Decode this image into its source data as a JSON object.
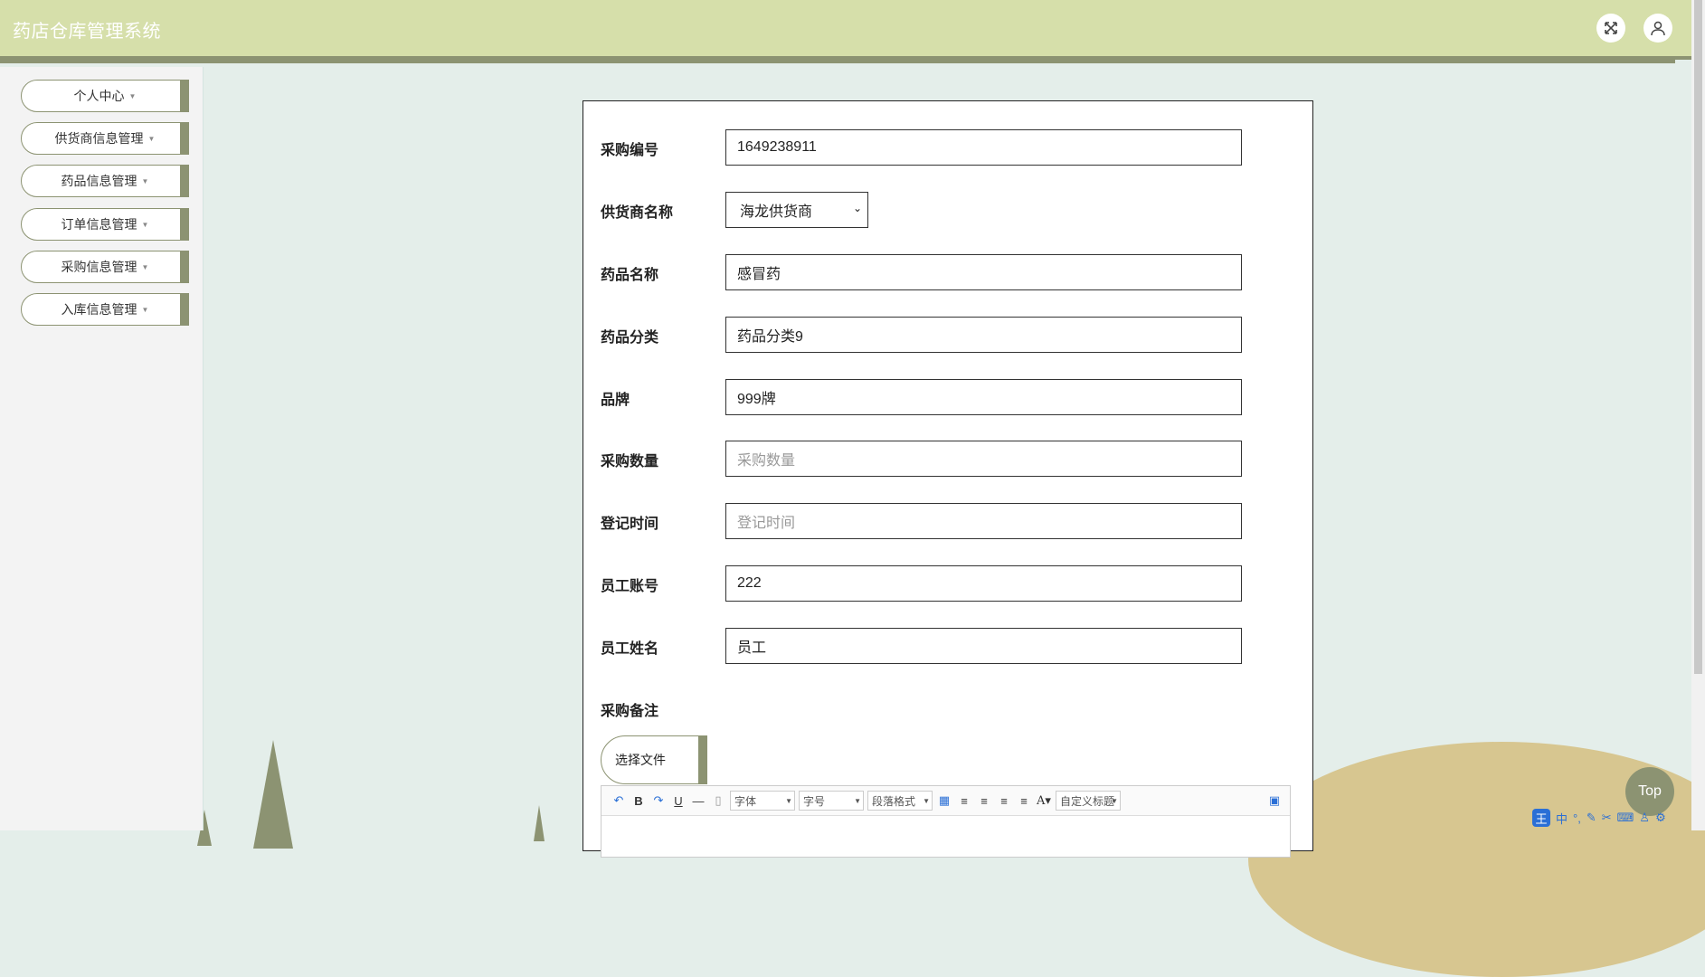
{
  "app": {
    "title": "药店仓库管理系统"
  },
  "header": {
    "fullscreen_icon": "expand-icon",
    "user_icon": "user-icon"
  },
  "sidebar": {
    "items": [
      {
        "label": "个人中心"
      },
      {
        "label": "供货商信息管理"
      },
      {
        "label": "药品信息管理"
      },
      {
        "label": "订单信息管理"
      },
      {
        "label": "采购信息管理"
      },
      {
        "label": "入库信息管理"
      }
    ]
  },
  "form": {
    "fields": [
      {
        "label": "采购编号",
        "value": "1649238911",
        "placeholder": ""
      },
      {
        "label": "供货商名称",
        "value": "海龙供货商",
        "type": "select"
      },
      {
        "label": "药品名称",
        "value": "感冒药",
        "placeholder": ""
      },
      {
        "label": "药品分类",
        "value": "药品分类9",
        "placeholder": ""
      },
      {
        "label": "品牌",
        "value": "999牌",
        "placeholder": ""
      },
      {
        "label": "采购数量",
        "value": "",
        "placeholder": "采购数量"
      },
      {
        "label": "登记时间",
        "value": "",
        "placeholder": "登记时间"
      },
      {
        "label": "员工账号",
        "value": "222",
        "placeholder": ""
      },
      {
        "label": "员工姓名",
        "value": "员工",
        "placeholder": ""
      }
    ],
    "remark_label": "采购备注",
    "file_button": "选择文件",
    "editor": {
      "font_label": "字体",
      "size_label": "字号",
      "paragraph_label": "段落格式",
      "custom_title_label": "自定义标题"
    }
  },
  "top_button": "Top",
  "ime": {
    "logo": "王",
    "mode": "中"
  },
  "colors": {
    "accent": "#8c9372",
    "header_bg": "#d6dfaa",
    "page_bg": "#e4eeea"
  }
}
